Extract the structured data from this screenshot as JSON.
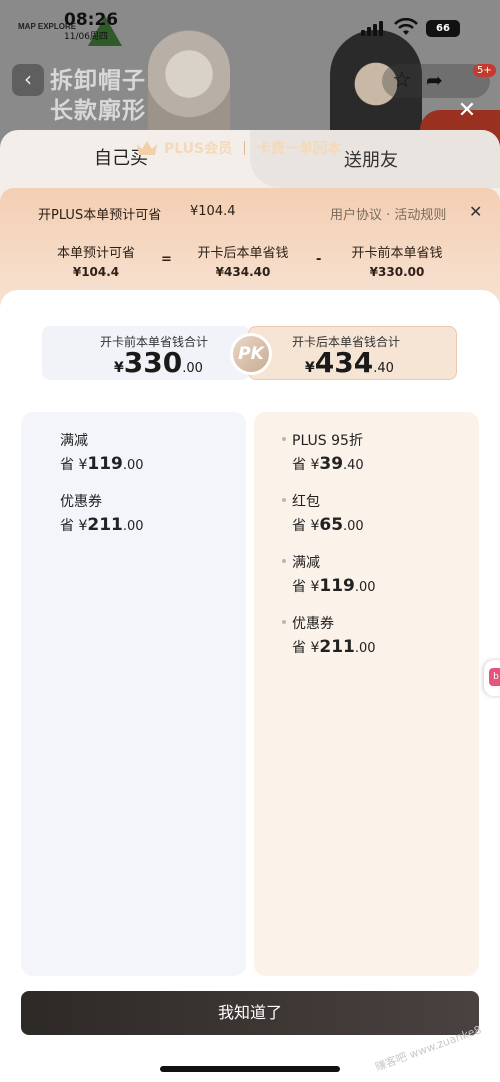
{
  "status": {
    "time": "08:26",
    "date": "11/06周四",
    "battery": "66"
  },
  "brand": {
    "logo_text": "MAP EXPLORE"
  },
  "product_bg": {
    "banner_text_line1": "拆卸帽子",
    "banner_text_line2": "长款廓形",
    "cart_badge": "5+"
  },
  "plus_banner": {
    "title": "PLUS会员",
    "subtitle": "卡费一单回本"
  },
  "tabs": {
    "left": "自己买",
    "right": "送朋友"
  },
  "tip": {
    "title": "开PLUS本单预计可省",
    "amount": "¥104.4",
    "links": "用户协议 · 活动规则",
    "formula": {
      "a_label": "本单预计可省",
      "a_value": "¥104.4",
      "op1": "=",
      "b_label": "开卡后本单省钱",
      "b_value": "¥434.40",
      "op2": "-",
      "c_label": "开卡前本单省钱",
      "c_value": "¥330.00"
    }
  },
  "pk": {
    "left_label": "开卡前本单省钱合计",
    "left_yen": "¥",
    "left_int": "330",
    "left_dec": ".00",
    "center": "PK",
    "right_label": "开卡后本单省钱合计",
    "right_yen": "¥",
    "right_int": "434",
    "right_dec": ".40"
  },
  "left_items": [
    {
      "name": "满减",
      "prefix": "省 ¥",
      "int": "119",
      "dec": ".00"
    },
    {
      "name": "优惠券",
      "prefix": "省 ¥",
      "int": "211",
      "dec": ".00"
    }
  ],
  "right_items": [
    {
      "name": "PLUS 95折",
      "prefix": "省 ¥",
      "int": "39",
      "dec": ".40"
    },
    {
      "name": "红包",
      "prefix": "省 ¥",
      "int": "65",
      "dec": ".00"
    },
    {
      "name": "满减",
      "prefix": "省 ¥",
      "int": "119",
      "dec": ".00"
    },
    {
      "name": "优惠券",
      "prefix": "省 ¥",
      "int": "211",
      "dec": ".00"
    }
  ],
  "confirm_label": "我知道了",
  "watermark": "赚客吧 www.zuanke8"
}
